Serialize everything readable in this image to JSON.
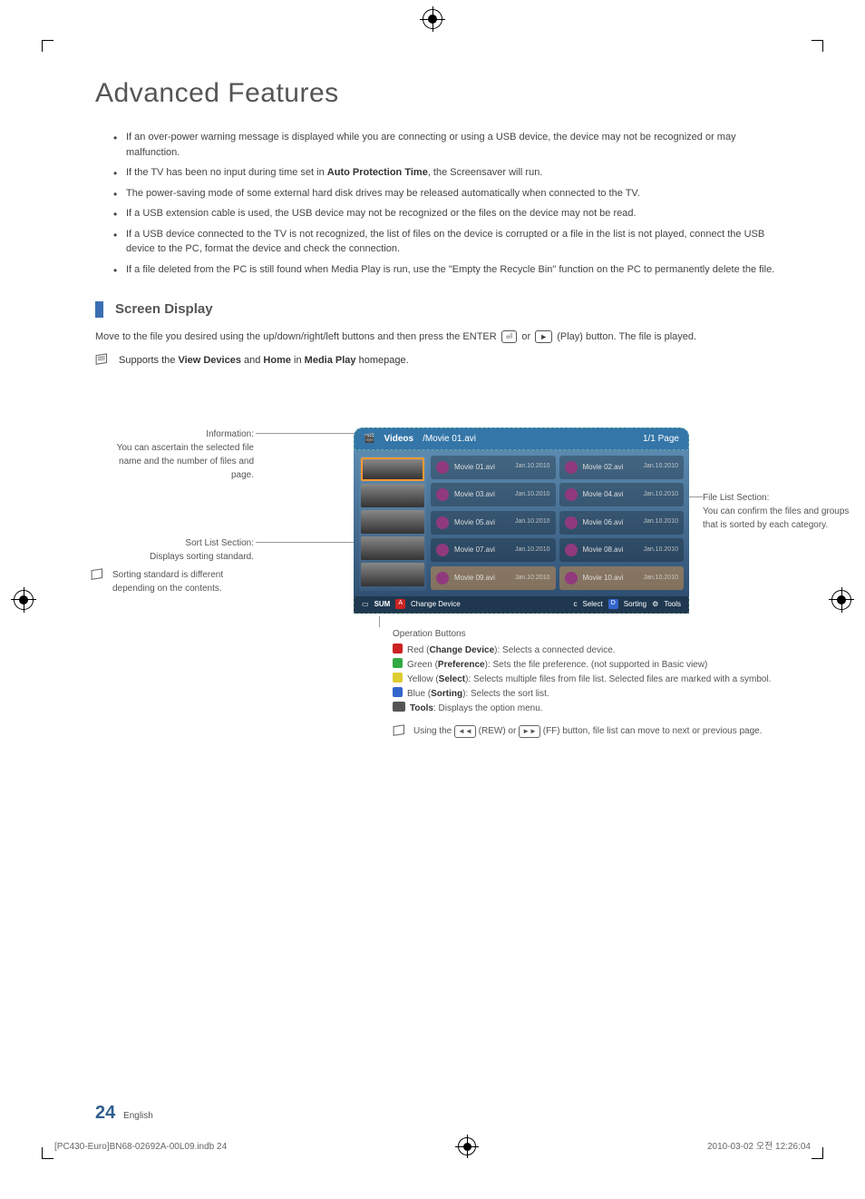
{
  "title": "Advanced Features",
  "bullets": [
    "If an over-power warning message is displayed while you are connecting or using a USB device, the device may not be recognized or may malfunction.",
    "If the TV has been no input during time set in <b>Auto Protection Time</b>, the Screensaver will run.",
    "The power-saving mode of some external hard disk drives may be released automatically when connected to the TV.",
    "If a USB extension cable is used, the USB device may not be recognized or the files on the device may not be read.",
    "If a USB device connected to the TV is not recognized, the list of files on the device is corrupted or a file in the list is not played, connect the USB device to the PC, format the device and check the connection.",
    "If a file deleted from the PC is still found when Media Play is run, use the \"Empty the Recycle Bin\" function on the PC to permanently delete the file."
  ],
  "section_title": "Screen Display",
  "para1_prefix": "Move to the file you desired using the up/down/right/left buttons and then press the ENTER",
  "para1_mid": " or ",
  "para1_suffix": " (Play) button. The file is played.",
  "note1": "Supports the <b>View Devices</b> and <b>Home</b> in <b>Media Play</b> homepage.",
  "callouts": {
    "info_head": "Information:",
    "info_body": "You can ascertain the selected file name and the number of files and page.",
    "sort_head": "Sort List Section:",
    "sort_body": "Displays sorting standard.",
    "sort_note": "Sorting standard is different depending on the contents.",
    "filelist_head": "File List Section:",
    "filelist_body": "You can confirm the files and groups that is sorted by each category."
  },
  "screenshot": {
    "category": "Videos",
    "path": "/Movie 01.avi",
    "page": "1/1 Page",
    "files": [
      {
        "n": "Movie 01.avi",
        "d": "Jan.10.2010"
      },
      {
        "n": "Movie 02.avi",
        "d": "Jan.10.2010"
      },
      {
        "n": "Movie 03.avi",
        "d": "Jan.10.2010"
      },
      {
        "n": "Movie 04.avi",
        "d": "Jan.10.2010"
      },
      {
        "n": "Movie 05.avi",
        "d": "Jan.10.2010"
      },
      {
        "n": "Movie 06.avi",
        "d": "Jan.10.2010"
      },
      {
        "n": "Movie 07.avi",
        "d": "Jan.10.2010"
      },
      {
        "n": "Movie 08.avi",
        "d": "Jan.10.2010"
      },
      {
        "n": "Movie 09.avi",
        "d": "Jan.10.2010"
      },
      {
        "n": "Movie 10.avi",
        "d": "Jan.10.2010"
      }
    ],
    "footerbar": {
      "sum": "SUM",
      "a": "Change Device",
      "c": "Select",
      "d": "Sorting",
      "t": "Tools"
    }
  },
  "operation": {
    "header": "Operation Buttons",
    "a": " Red (<b>Change Device</b>): Selects a connected device.",
    "b": " Green (<b>Preference</b>): Sets the file preference. (not supported in Basic view)",
    "c": " Yellow (<b>Select</b>): Selects multiple files from file list. Selected files are marked with a symbol.",
    "d": " Blue (<b>Sorting</b>): Selects the sort list.",
    "t": " <b>Tools</b>: Displays the option menu.",
    "note_prefix": "Using the ",
    "note_rew": " (REW) or ",
    "note_suffix": " (FF) button, file list can move to next or previous page."
  },
  "footer": {
    "num": "24",
    "lang": "English"
  },
  "meta": {
    "left": "[PC430-Euro]BN68-02692A-00L09.indb   24",
    "right": "2010-03-02   오전 12:26:04"
  }
}
